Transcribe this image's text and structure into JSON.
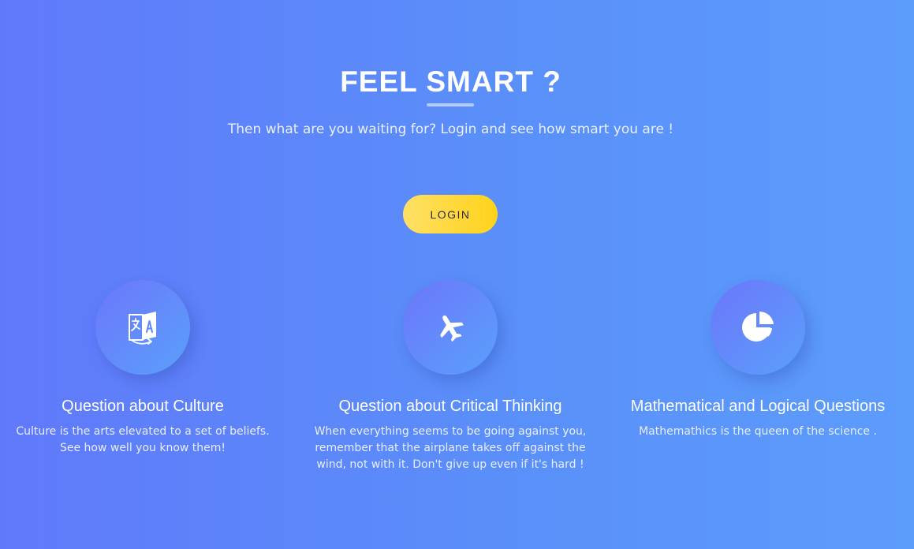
{
  "hero": {
    "title": "FEEL SMART ?",
    "subtitle": "Then what are you waiting for? Login and see how smart you are !",
    "login_label": "LOGIN"
  },
  "features": [
    {
      "icon": "language-translate-icon",
      "title": "Question about Culture",
      "text": "Culture is the arts elevated to a set of beliefs. See how well you know them!"
    },
    {
      "icon": "airplane-icon",
      "title": "Question about Critical Thinking",
      "text": "When everything seems to be going against you, remember that the airplane takes off against the wind, not with it. Don't give up even if it's hard !"
    },
    {
      "icon": "pie-chart-icon",
      "title": "Mathematical and Logical Questions",
      "text": "Mathemathics is the queen of the science ."
    }
  ],
  "colors": {
    "background_start": "#6079fb",
    "background_end": "#5c9cfb",
    "button_start": "#ffe065",
    "button_end": "#ffd21a"
  }
}
